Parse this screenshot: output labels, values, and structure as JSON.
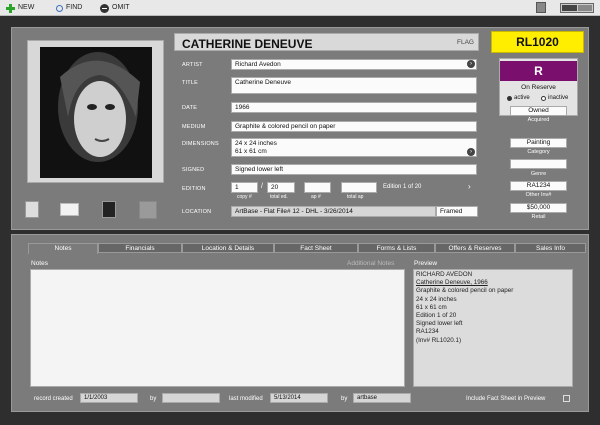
{
  "toolbar": {
    "new": "NEW",
    "find": "FIND",
    "omit": "OMIT"
  },
  "record": {
    "title": "CATHERINE DENEUVE",
    "flag": "FLAG",
    "id": "RL1020",
    "status_letter": "R",
    "status_text": "On Reserve",
    "radio_active": "active",
    "radio_inactive": "inactive",
    "owned": "Owned",
    "acquired_label": "Acquired",
    "category": "Painting",
    "category_label": "Category",
    "genre": "",
    "genre_label": "Genre",
    "other_inv": "RA1234",
    "other_inv_label": "Other Inv#",
    "retail": "$50,000",
    "retail_label": "Retail"
  },
  "fields": {
    "artist_label": "ARTIST",
    "artist": "Richard Avedon",
    "title_label": "TITLE",
    "title": "Catherine Deneuve",
    "date_label": "DATE",
    "date": "1966",
    "medium_label": "MEDIUM",
    "medium": "Graphite & colored pencil on paper",
    "dimensions_label": "DIMENSIONS",
    "dimensions": "24 x 24 inches\n61 x 61 cm",
    "signed_label": "SIGNED",
    "signed": "Signed lower left",
    "edition_label": "EDITION",
    "edition_copy": "1",
    "edition_total": "20",
    "edition_ap": "",
    "edition_total_ap": "",
    "copy_label": "copy #",
    "total_ed_label": "total ed.",
    "ap_label": "ap #",
    "total_ap_label": "total ap",
    "edition_text": "Edition 1 of 20",
    "location_label": "LOCATION",
    "location": "ArtBase - Flat File# 12 - DHL - 3/26/2014",
    "framed": "Framed"
  },
  "tabs": [
    "Notes",
    "Financials",
    "Location & Details",
    "Fact Sheet",
    "Forms & Lists",
    "Offers & Reserves",
    "Sales Info"
  ],
  "notes": {
    "label": "Notes",
    "additional": "Additional Notes",
    "text": ""
  },
  "preview": {
    "label": "Preview",
    "lines": [
      "RICHARD AVEDON",
      "Catherine Deneuve, 1966",
      "Graphite & colored pencil on paper",
      "24 x 24 inches",
      "61 x 61 cm",
      "Edition 1 of 20",
      "Signed lower left",
      "RA1234",
      "(Inv# RL1020.1)"
    ]
  },
  "footer": {
    "record_created_label": "record created",
    "record_created": "1/1/2003",
    "by1_label": "by",
    "by1": "",
    "last_modified_label": "last modified",
    "last_modified": "5/13/2014",
    "by2_label": "by",
    "by2": "artbase",
    "include_label": "Include Fact Sheet in Preview"
  },
  "colors": {
    "id_bg": "#ffee00",
    "status_bg": "#7a0f6e"
  }
}
